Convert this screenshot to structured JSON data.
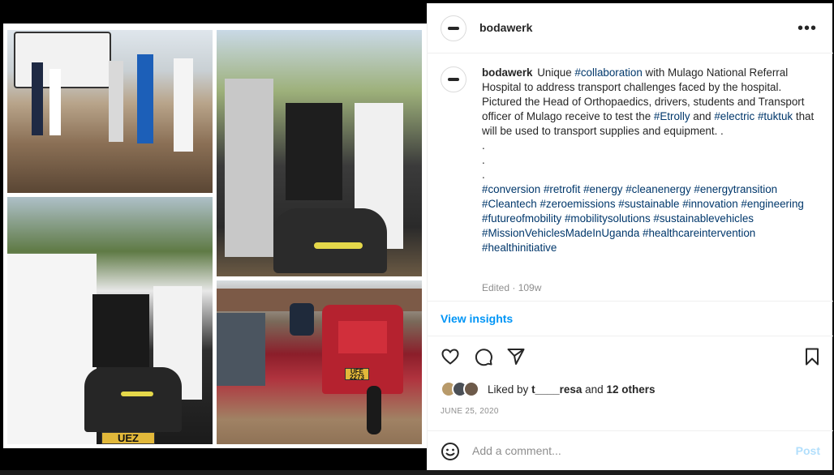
{
  "post": {
    "username": "bodawerk",
    "caption_user": "bodawerk",
    "caption_parts": [
      {
        "t": "Unique ",
        "tag": false
      },
      {
        "t": "#collaboration",
        "tag": true
      },
      {
        "t": " with Mulago National Referral Hospital to address transport challenges faced by the hospital. Pictured the Head of Orthopaedics, drivers, students and Transport officer of Mulago receive to test the ",
        "tag": false
      },
      {
        "t": "#Etrolly",
        "tag": true
      },
      {
        "t": " and ",
        "tag": false
      },
      {
        "t": "#electric",
        "tag": true
      },
      {
        "t": " ",
        "tag": false
      },
      {
        "t": "#tuktuk",
        "tag": true
      },
      {
        "t": " that will be used to transport supplies and equipment. .",
        "tag": false
      }
    ],
    "dots": [
      ".",
      ".",
      "."
    ],
    "hashtags": [
      "#conversion",
      "#retrofit",
      "#energy",
      "#cleanenergy",
      "#energytransition",
      "#Cleantech",
      "#zeroemissions",
      "#sustainable",
      "#innovation",
      "#engineering",
      "#futureofmobility",
      "#mobilitysolutions",
      "#sustainablevehicles",
      "#MissionVehiclesMadeInUganda",
      "#healthcareintervention",
      "#healthinitiative"
    ],
    "edited": "Edited",
    "edited_age": "109w",
    "insights_label": "View insights",
    "liked_prefix": "Liked by",
    "liked_user": "t____resa",
    "liked_and": "and",
    "liked_others": "12 others",
    "date": "JUNE 25, 2020",
    "comment_placeholder": "Add a comment...",
    "post_label": "Post"
  },
  "media": {
    "plate_top": "UEZ",
    "plate_red": "UFE\n2273"
  },
  "icons": [
    "more-options-icon",
    "like-icon",
    "comment-icon",
    "share-icon",
    "save-icon",
    "emoji-icon"
  ],
  "colors": {
    "link": "#00376b",
    "accent": "#0095f6",
    "post_disabled": "#b2dffc",
    "muted": "#8e8e8e"
  }
}
